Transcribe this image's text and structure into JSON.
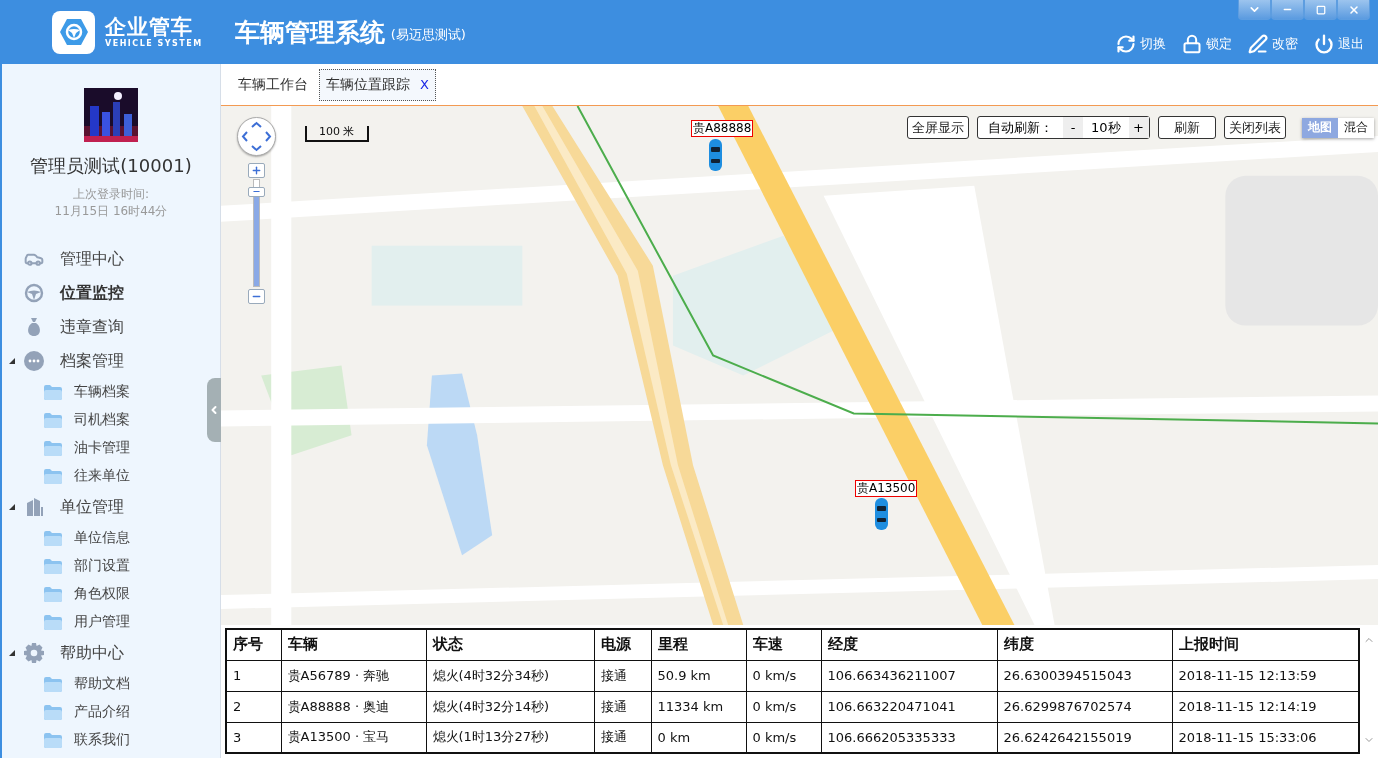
{
  "header": {
    "logo_title": "企业管车",
    "logo_subtitle": "VEHICLE SYSTEM",
    "title": "车辆管理系统",
    "subtitle": "(易迈思测试)",
    "actions": [
      {
        "kind": "switch",
        "label": "切换"
      },
      {
        "kind": "lock",
        "label": "锁定"
      },
      {
        "kind": "password",
        "label": "改密"
      },
      {
        "kind": "logout",
        "label": "退出"
      }
    ]
  },
  "window_controls": [
    {
      "kind": "menu"
    },
    {
      "kind": "minimize"
    },
    {
      "kind": "maximize"
    },
    {
      "kind": "close"
    }
  ],
  "user": {
    "name": "管理员测试(10001)",
    "last_login_label": "上次登录时间:",
    "last_login": "11月15日 16时44分"
  },
  "sidebar": {
    "items": [
      {
        "kind": "car",
        "label": "管理中心",
        "selected": false
      },
      {
        "kind": "wheel",
        "label": "位置监控",
        "selected": true
      },
      {
        "kind": "bag",
        "label": "违章查询",
        "selected": false
      },
      {
        "kind": "dots",
        "label": "档案管理",
        "selected": false,
        "expanded": true,
        "children": [
          {
            "label": "车辆档案",
            "selected": false
          },
          {
            "label": "司机档案",
            "selected": false
          },
          {
            "label": "油卡管理",
            "selected": false
          },
          {
            "label": "往来单位",
            "selected": false
          }
        ]
      },
      {
        "kind": "building",
        "label": "单位管理",
        "selected": false,
        "expanded": true,
        "children": [
          {
            "label": "单位信息",
            "selected": false
          },
          {
            "label": "部门设置",
            "selected": false
          },
          {
            "label": "角色权限",
            "selected": false
          },
          {
            "label": "用户管理",
            "selected": false
          }
        ]
      },
      {
        "kind": "gear",
        "label": "帮助中心",
        "selected": false,
        "expanded": true,
        "children": [
          {
            "label": "帮助文档",
            "selected": false
          },
          {
            "label": "产品介绍",
            "selected": false
          },
          {
            "label": "联系我们",
            "selected": false
          }
        ]
      }
    ]
  },
  "tabs": [
    {
      "label": "车辆工作台",
      "selected": false
    },
    {
      "label": "车辆位置跟踪",
      "selected": true,
      "close_label": "X"
    }
  ],
  "map": {
    "scale": "100 米",
    "zoom": {
      "level": 0.92
    },
    "toolbar": {
      "fullscreen": "全屏显示",
      "auto_refresh_label": "自动刷新：",
      "decrement": "-",
      "interval": "10秒",
      "increment": "+",
      "refresh": "刷新",
      "close_list": "关闭列表"
    },
    "map_types": [
      {
        "label": "地图",
        "selected": true
      },
      {
        "label": "混合",
        "selected": false
      }
    ],
    "vehicles": [
      {
        "plate": "贵A88888"
      },
      {
        "plate": "贵A13500"
      }
    ]
  },
  "table": {
    "columns": [
      "序号",
      "车辆",
      "状态",
      "电源",
      "里程",
      "车速",
      "经度",
      "纬度",
      "上报时间"
    ],
    "rows": [
      [
        "1",
        "贵A56789 · 奔驰",
        "熄火(4时32分34秒)",
        "接通",
        "50.9 km",
        "0 km/s",
        "106.663436211007",
        "26.6300394515043",
        "2018-11-15 12:13:59"
      ],
      [
        "2",
        "贵A88888 · 奥迪",
        "熄火(4时32分14秒)",
        "接通",
        "11334 km",
        "0 km/s",
        "106.663220471041",
        "26.6299876702574",
        "2018-11-15 12:14:19"
      ],
      [
        "3",
        "贵A13500 · 宝马",
        "熄火(1时13分27秒)",
        "接通",
        "0 km",
        "0 km/s",
        "106.666205335333",
        "26.6242642155019",
        "2018-11-15 15:33:06"
      ]
    ]
  }
}
